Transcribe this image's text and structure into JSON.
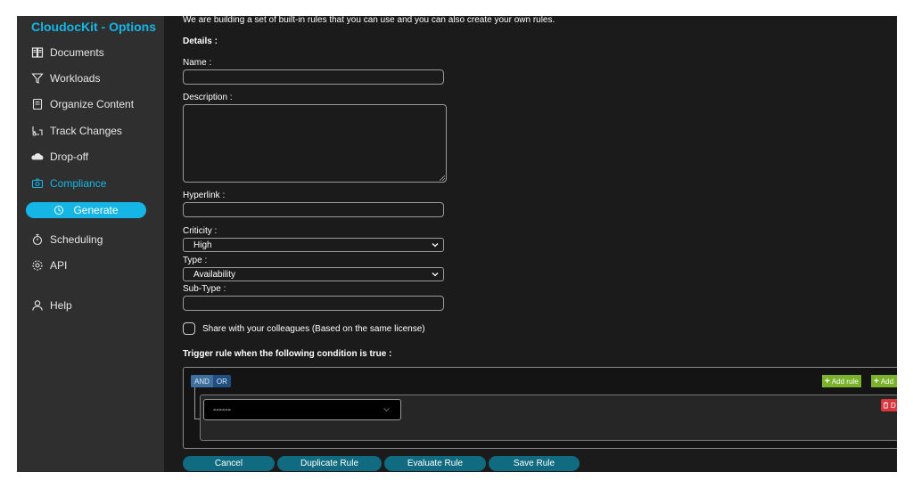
{
  "sidebar": {
    "brand": "CloudocKit - Options",
    "items": [
      {
        "label": "Documents",
        "icon": "documents-icon"
      },
      {
        "label": "Workloads",
        "icon": "filter-icon"
      },
      {
        "label": "Organize Content",
        "icon": "organize-icon"
      },
      {
        "label": "Track Changes",
        "icon": "track-changes-icon"
      },
      {
        "label": "Drop-off",
        "icon": "cloud-icon"
      },
      {
        "label": "Compliance",
        "icon": "camera-icon",
        "active": true
      },
      {
        "label": "Scheduling",
        "icon": "stopwatch-icon"
      },
      {
        "label": "API",
        "icon": "gear-icon"
      },
      {
        "label": "Help",
        "icon": "user-icon"
      }
    ],
    "sub_item": {
      "label": "Generate",
      "icon": "generate-icon"
    }
  },
  "content": {
    "intro": "We are building a set of built-in rules that you can use and you can also create your own rules.",
    "details_heading": "Details :",
    "name_label": "Name :",
    "name_value": "",
    "description_label": "Description :",
    "description_value": "",
    "hyperlink_label": "Hyperlink :",
    "hyperlink_value": "",
    "criticity_label": "Criticity :",
    "criticity_value": "High",
    "type_label": "Type :",
    "type_value": "Availability",
    "subtype_label": "Sub-Type :",
    "subtype_value": "",
    "share_label": "Share with your colleagues (Based on the same license)",
    "share_checked": false,
    "trigger_heading": "Trigger rule when the following condition is true :"
  },
  "rule_builder": {
    "and_label": "AND",
    "or_label": "OR",
    "add_rule_label": "Add rule",
    "add_group_label": "Add",
    "rule_field_value": "------",
    "delete_label": "D"
  },
  "actions": {
    "cancel": "Cancel",
    "duplicate": "Duplicate Rule",
    "evaluate": "Evaluate Rule",
    "save": "Save Rule"
  },
  "colors": {
    "accent": "#15b6e6",
    "sidebar_bg": "#2f2f2f",
    "content_bg": "#1b1b1b",
    "button_bg": "#116b80",
    "add_green": "#7ab22c",
    "delete_red": "#d9363e",
    "logic_blue": "#1f4f82"
  }
}
